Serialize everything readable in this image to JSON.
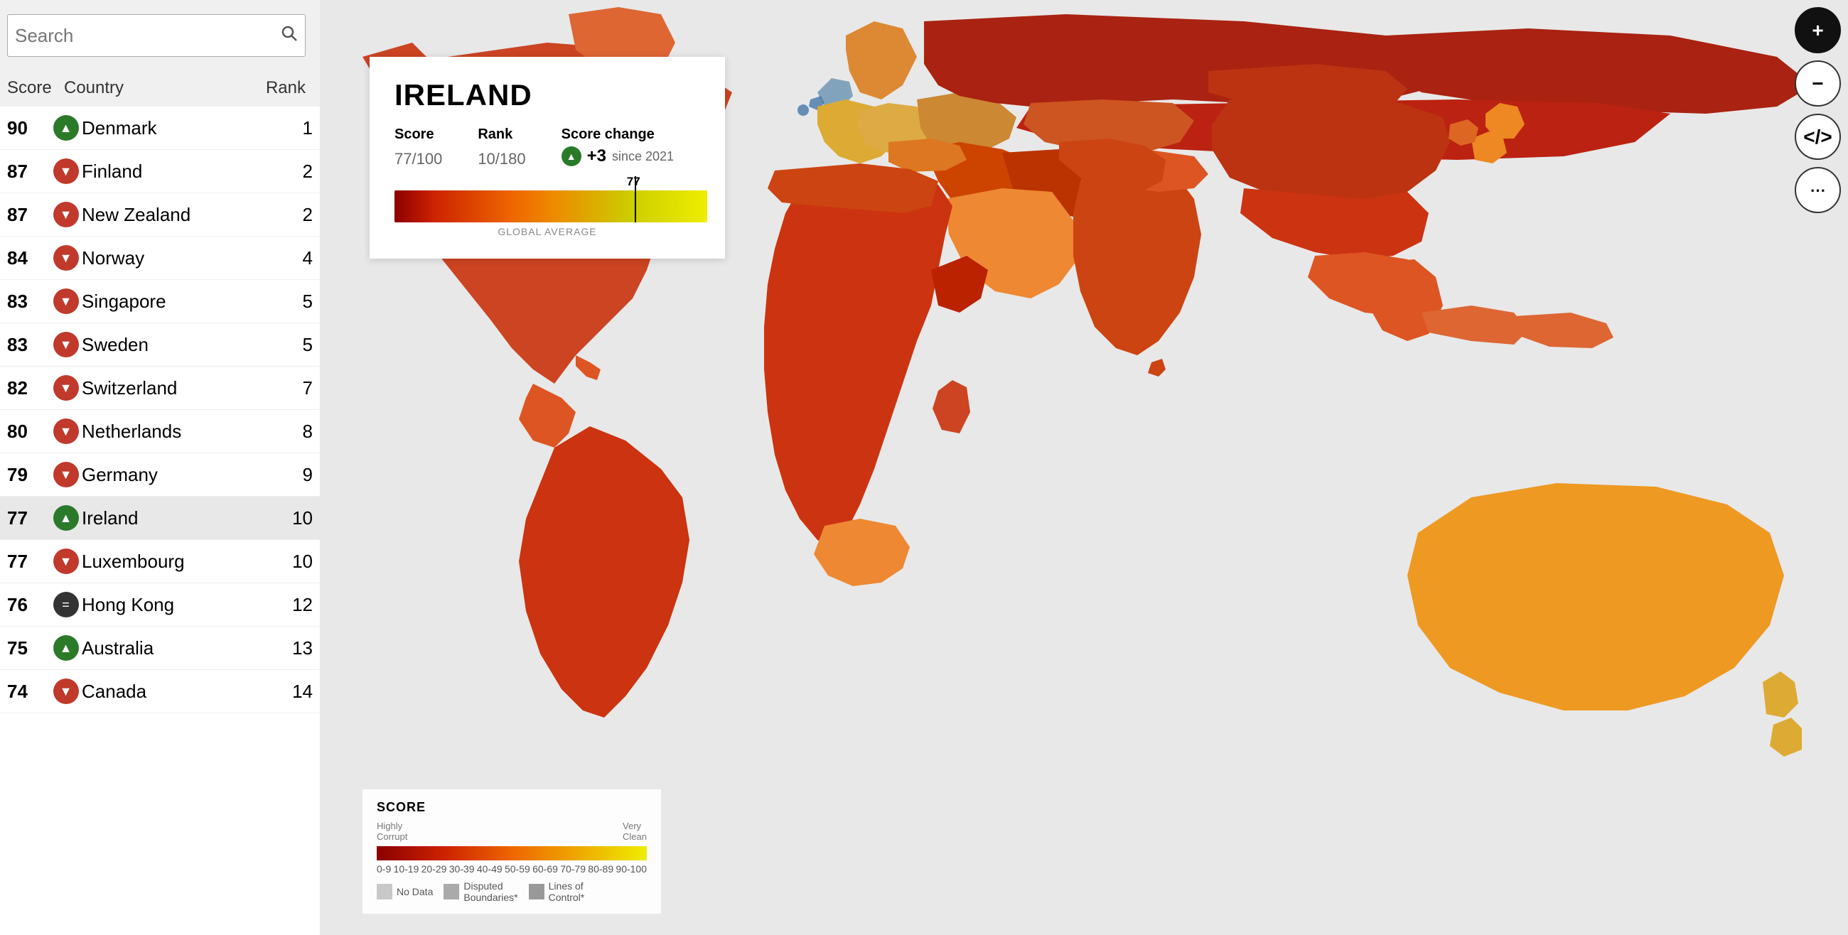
{
  "search": {
    "placeholder": "Search"
  },
  "table": {
    "headers": {
      "score": "Score",
      "country": "Country",
      "rank": "Rank"
    },
    "rows": [
      {
        "score": 90,
        "arrow": "up",
        "country": "Denmark",
        "rank": 1
      },
      {
        "score": 87,
        "arrow": "down",
        "country": "Finland",
        "rank": 2
      },
      {
        "score": 87,
        "arrow": "down",
        "country": "New Zealand",
        "rank": 2
      },
      {
        "score": 84,
        "arrow": "down",
        "country": "Norway",
        "rank": 4
      },
      {
        "score": 83,
        "arrow": "down",
        "country": "Singapore",
        "rank": 5
      },
      {
        "score": 83,
        "arrow": "down",
        "country": "Sweden",
        "rank": 5
      },
      {
        "score": 82,
        "arrow": "down",
        "country": "Switzerland",
        "rank": 7
      },
      {
        "score": 80,
        "arrow": "down",
        "country": "Netherlands",
        "rank": 8
      },
      {
        "score": 79,
        "arrow": "down",
        "country": "Germany",
        "rank": 9
      },
      {
        "score": 77,
        "arrow": "up",
        "country": "Ireland",
        "rank": 10,
        "selected": true
      },
      {
        "score": 77,
        "arrow": "down",
        "country": "Luxembourg",
        "rank": 10
      },
      {
        "score": 76,
        "arrow": "same",
        "country": "Hong Kong",
        "rank": 12
      },
      {
        "score": 75,
        "arrow": "up",
        "country": "Australia",
        "rank": 13
      },
      {
        "score": 74,
        "arrow": "down",
        "country": "Canada",
        "rank": 14
      }
    ]
  },
  "popup": {
    "country": "IRELAND",
    "score_label": "Score",
    "rank_label": "Rank",
    "score_change_label": "Score change",
    "score": "77",
    "score_denom": "/100",
    "rank": "10",
    "rank_denom": "/180",
    "change_value": "+3",
    "change_since": "since 2021",
    "score_bar_marker": "77",
    "global_avg_label": "GLOBAL AVERAGE"
  },
  "legend": {
    "title": "SCORE",
    "labels": [
      "0-9",
      "10-19",
      "20-29",
      "30-39",
      "40-49",
      "50-59",
      "60-69",
      "70-79",
      "80-89",
      "90-100"
    ],
    "left_label": "Highly\nCorrupt",
    "right_label": "Very\nClean",
    "no_data": "No Data",
    "disputed": "Disputed\nBoundaries*",
    "lines_of": "Lines of\nControl*"
  },
  "controls": {
    "zoom_in": "+",
    "zoom_out": "−",
    "embed": "</>",
    "share": "⋯"
  },
  "arrows": {
    "up": "▲",
    "down": "▼",
    "same": "="
  }
}
